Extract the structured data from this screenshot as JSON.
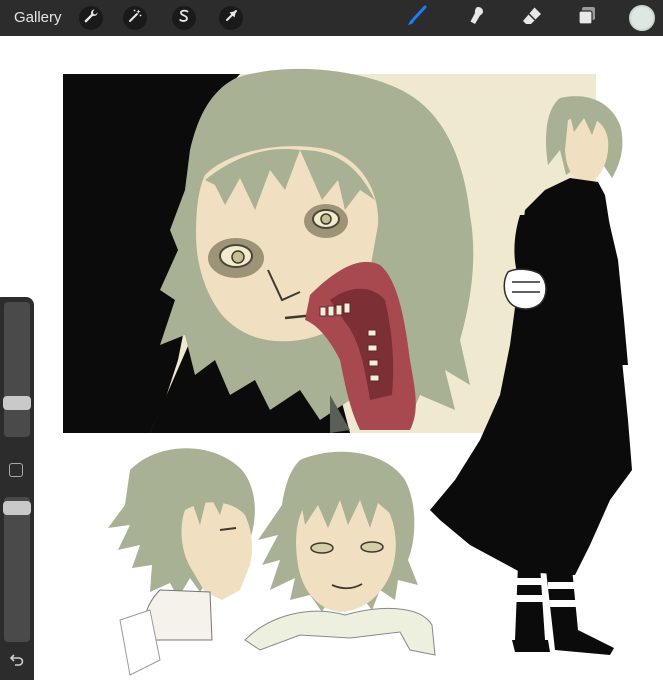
{
  "toolbar": {
    "gallery_label": "Gallery",
    "left_tools": [
      {
        "name": "actions",
        "icon": "wrench-icon"
      },
      {
        "name": "adjustments",
        "icon": "magic-wand-icon"
      },
      {
        "name": "selection",
        "icon": "selection-s-icon"
      },
      {
        "name": "transform",
        "icon": "arrow-cursor-icon"
      }
    ],
    "right_tools": [
      {
        "name": "brush",
        "icon": "brush-icon",
        "active": true
      },
      {
        "name": "smudge",
        "icon": "smudge-icon"
      },
      {
        "name": "eraser",
        "icon": "eraser-icon"
      },
      {
        "name": "layers",
        "icon": "layers-icon"
      }
    ],
    "active_color": "#dfe7e2",
    "accent": "#1f7cf7"
  },
  "sidebar": {
    "brush_size_level": 0.22,
    "opacity_level": 0.97
  },
  "palette": {
    "hair": "#a8b193",
    "skin": "#f1dfc1",
    "background_cream": "#efe9cf",
    "black": "#0b0b0b",
    "blood": "#a8484f"
  }
}
